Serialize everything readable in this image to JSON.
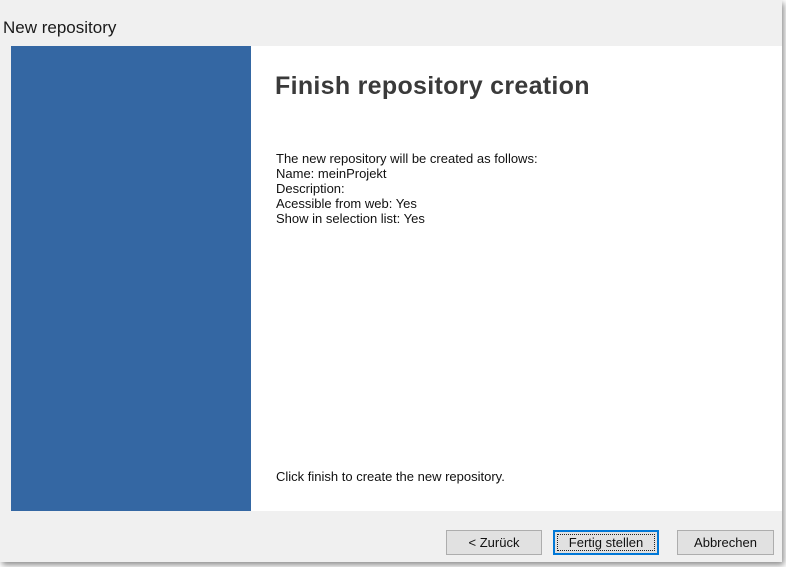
{
  "window": {
    "title": "New repository"
  },
  "page": {
    "heading": "Finish repository creation",
    "summary_lines": [
      "The new repository will be created as follows:",
      "Name: meinProjekt",
      "Description:",
      "Acessible from web: Yes",
      "Show in selection list: Yes"
    ],
    "footer_note": "Click finish to create the new repository."
  },
  "buttons": {
    "back_label": "< Zurück",
    "finish_label": "Fertig stellen",
    "cancel_label": "Abbrechen"
  },
  "colors": {
    "sidebar": "#3467a3",
    "accent_focus": "#0078d7"
  }
}
